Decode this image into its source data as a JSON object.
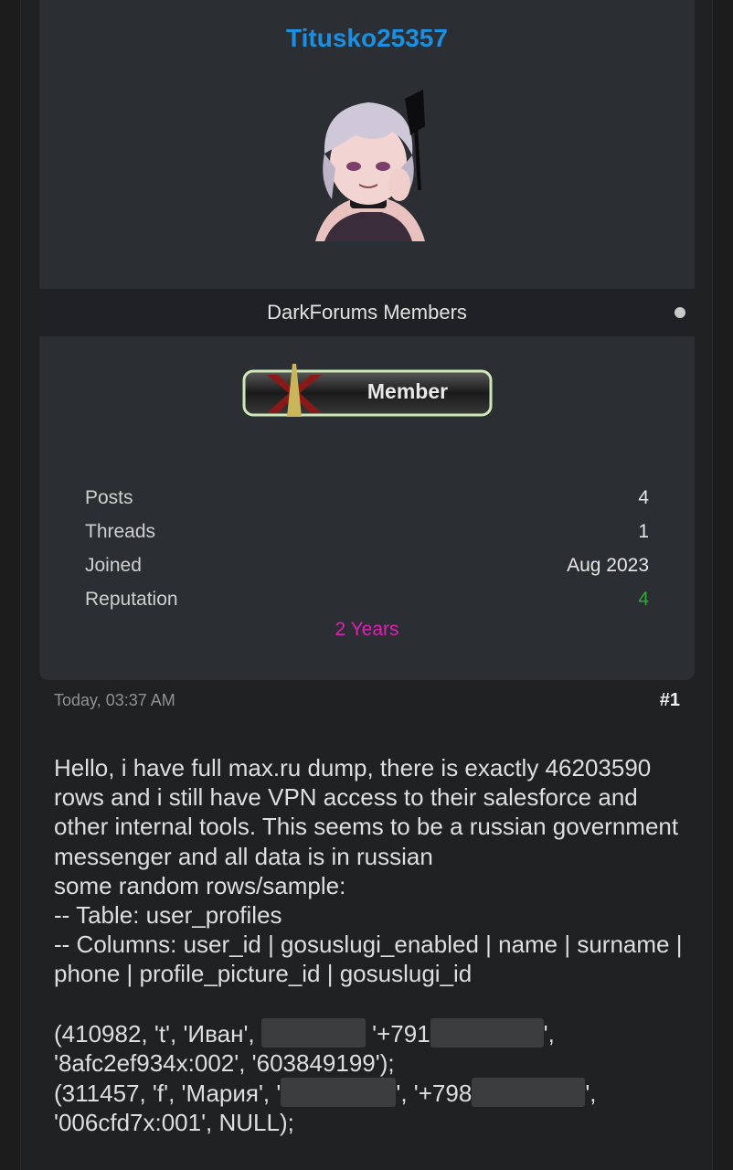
{
  "profile": {
    "username": "Titusko25357",
    "group": "DarkForums Members",
    "badge_label": "Member",
    "stats": [
      {
        "label": "Posts",
        "value": "4"
      },
      {
        "label": "Threads",
        "value": "1"
      },
      {
        "label": "Joined",
        "value": "Aug 2023"
      },
      {
        "label": "Reputation",
        "value": "4"
      }
    ],
    "tenure": "2 Years"
  },
  "post": {
    "date": "Today, 03:37 AM",
    "number": "#1",
    "intro": "Hello, i have full max.ru dump, there is exactly 46203590 rows and i still have VPN access to their salesforce and other internal tools. This seems to be a russian government messenger and all data is in russian",
    "sample_label": "some random rows/sample:",
    "table_line": "-- Table: user_profiles",
    "columns_line": "-- Columns: user_id | gosuslugi_enabled | name | surname | phone | profile_picture_id | gosuslugi_id",
    "row1_part1": "(410982, 't', 'Иван',",
    "row1_part2": "'+791",
    "row1_part3": "',",
    "row1_part4": "'8afc2ef934x:002', '603849199');",
    "row2_part1": "(311457, 'f', 'Мария', '",
    "row2_part2": "', '+798",
    "row2_part3": "',",
    "row2_part4": "'006cfd7x:001', NULL);"
  },
  "colors": {
    "username": "#1d8fe0",
    "reputation": "#2eaa2e",
    "tenure": "#e01fb4",
    "card": "#2b2f33",
    "page": "#202122"
  }
}
